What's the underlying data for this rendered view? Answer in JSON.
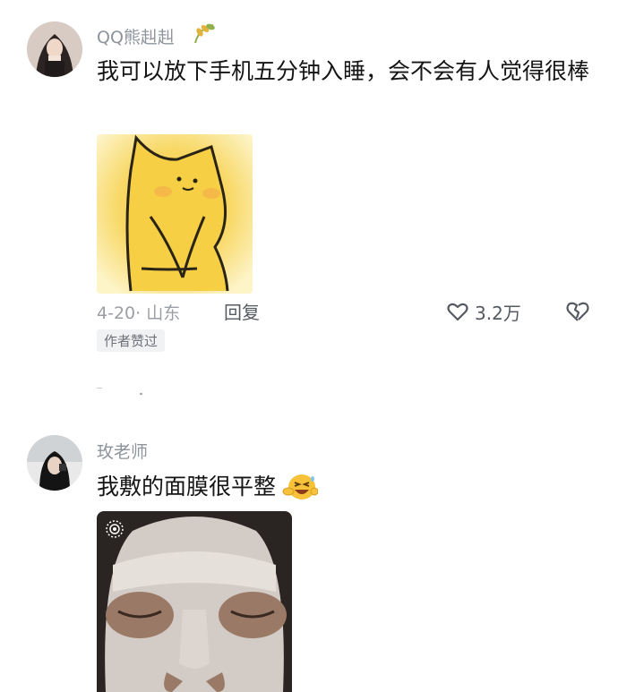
{
  "comments": [
    {
      "username": "QQ熊赳赳",
      "text": "我可以放下手机五分钟入睡，会不会有人觉得很棒",
      "date_location": "4-20· 山东",
      "reply_label": "回复",
      "like_count": "3.2万",
      "badge": "作者赞过"
    },
    {
      "username": "玫老师",
      "text": "我敷的面膜很平整"
    }
  ]
}
